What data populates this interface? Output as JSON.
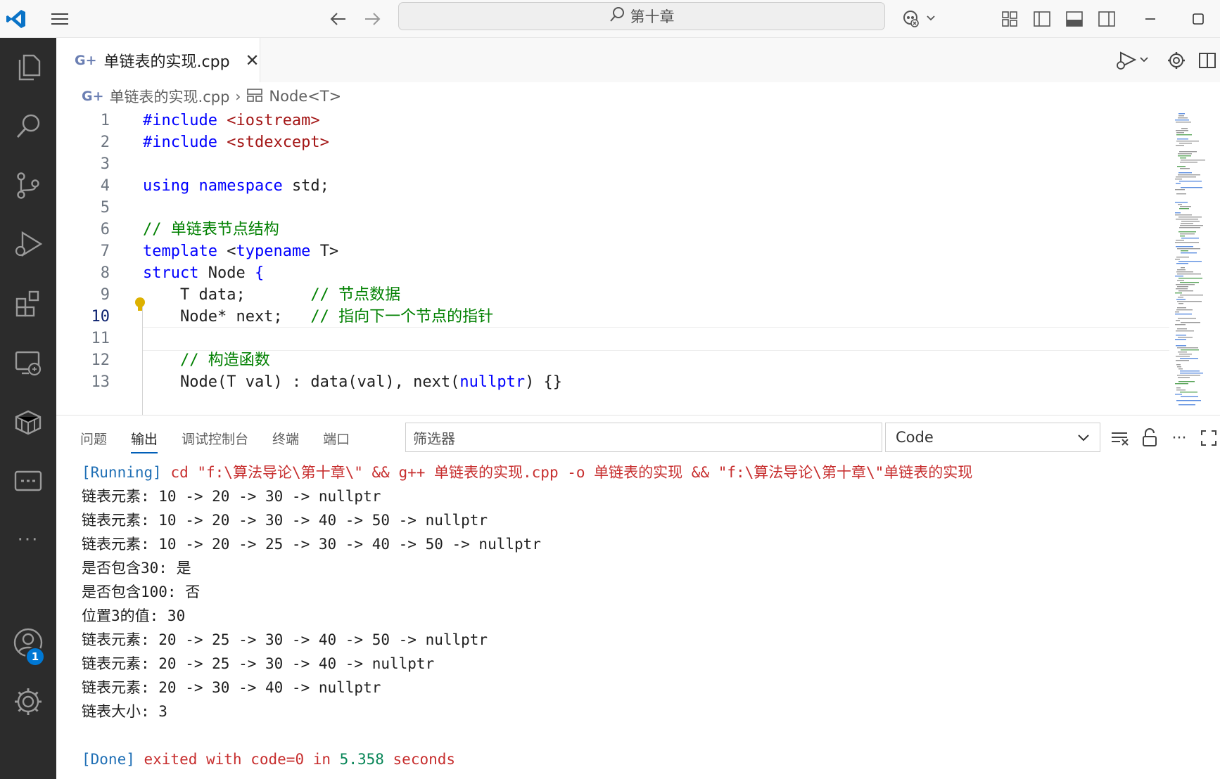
{
  "titlebar": {
    "search_text": "第十章"
  },
  "tab": {
    "filename": "单链表的实现.cpp",
    "close_glyph": "✕",
    "cpp_glyph": "G+"
  },
  "breadcrumb": {
    "file": "单链表的实现.cpp",
    "symbol": "Node<T>"
  },
  "editor": {
    "current_line": 10,
    "lines": [
      {
        "n": "1",
        "tokens": [
          [
            "kw",
            "#include "
          ],
          [
            "str",
            "<iostream>"
          ]
        ]
      },
      {
        "n": "2",
        "tokens": [
          [
            "kw",
            "#include "
          ],
          [
            "str",
            "<stdexcept>"
          ]
        ]
      },
      {
        "n": "3",
        "tokens": []
      },
      {
        "n": "4",
        "tokens": [
          [
            "kw",
            "using "
          ],
          [
            "kw",
            "namespace "
          ],
          [
            "pl",
            "std;"
          ]
        ]
      },
      {
        "n": "5",
        "tokens": []
      },
      {
        "n": "6",
        "tokens": [
          [
            "cm",
            "// 单链表节点结构"
          ]
        ]
      },
      {
        "n": "7",
        "tokens": [
          [
            "kw",
            "template "
          ],
          [
            "pl",
            "<"
          ],
          [
            "kw",
            "typename "
          ],
          [
            "pl",
            "T>"
          ]
        ]
      },
      {
        "n": "8",
        "tokens": [
          [
            "kw",
            "struct "
          ],
          [
            "pl",
            "Node "
          ],
          [
            "kw",
            "{"
          ]
        ]
      },
      {
        "n": "9",
        "tokens": [
          [
            "pl",
            "    T data;       "
          ],
          [
            "cm",
            "// 节点数据"
          ]
        ]
      },
      {
        "n": "10",
        "tokens": [
          [
            "pl",
            "    Node* next;   "
          ],
          [
            "cm",
            "// 指向下一个节点的指针"
          ]
        ]
      },
      {
        "n": "11",
        "tokens": []
      },
      {
        "n": "12",
        "tokens": [
          [
            "pl",
            "    "
          ],
          [
            "cm",
            "// 构造函数"
          ]
        ]
      },
      {
        "n": "13",
        "tokens": [
          [
            "pl",
            "    Node(T val) : data(val), next("
          ],
          [
            "kw",
            "nullptr"
          ],
          [
            "pl",
            ") {}"
          ]
        ]
      }
    ]
  },
  "panel": {
    "tabs": [
      "问题",
      "输出",
      "调试控制台",
      "终端",
      "端口"
    ],
    "active_tab": "输出",
    "filter_placeholder": "筛选器",
    "channel": "Code",
    "output": {
      "run_tag": "[Running]",
      "run_cmd": " cd \"f:\\算法导论\\第十章\\\" && g++ 单链表的实现.cpp -o 单链表的实现 && \"f:\\算法导论\\第十章\\\"单链表的实现",
      "lines": [
        "链表元素: 10 -> 20 -> 30 -> nullptr",
        "链表元素: 10 -> 20 -> 30 -> 40 -> 50 -> nullptr",
        "链表元素: 10 -> 20 -> 25 -> 30 -> 40 -> 50 -> nullptr",
        "是否包含30: 是",
        "是否包含100: 否",
        "位置3的值: 30",
        "链表元素: 20 -> 25 -> 30 -> 40 -> 50 -> nullptr",
        "链表元素: 20 -> 25 -> 30 -> 40 -> nullptr",
        "链表元素: 20 -> 30 -> 40 -> nullptr",
        "链表大小: 3"
      ],
      "done_tag": "[Done]",
      "done_text_1": " exited with ",
      "done_code": "code=0",
      "done_text_2": " in ",
      "done_time": "5.358",
      "done_text_3": " seconds"
    }
  },
  "account_badge": "1",
  "colors": {
    "keyword": "#0000ff",
    "string": "#a31515",
    "comment": "#008000",
    "activity_bar": "#2c2c2c",
    "accent": "#005fb8"
  }
}
